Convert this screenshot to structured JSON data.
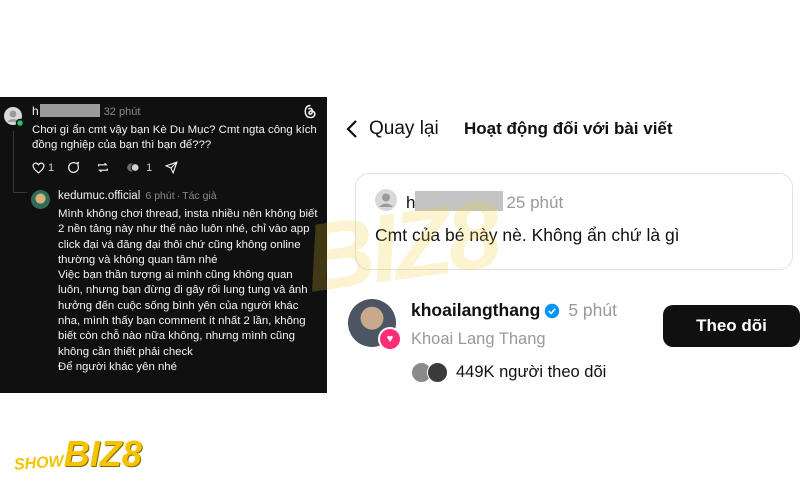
{
  "left_thread": {
    "comment": {
      "username_visible": "h",
      "time": "32 phút",
      "text": "Chơi gì ẩn cmt vậy bạn Kè Du Mục? Cmt ngta công kích đồng nghiệp của bạn thì bạn để???",
      "likes": "1",
      "reposts": "1"
    },
    "reply": {
      "username": "kedumuc.official",
      "time": "6 phút",
      "role": "Tác giả",
      "paragraphs": [
        "Mình không chơi thread, insta nhiều nên không biết 2 nền tảng này như thế nào luôn nhé, chỉ vào app click đại và đăng đại thôi chứ cũng không online thường và không quan tâm nhé",
        "Việc bạn thần tượng ai mình cũng không quan luôn, nhưng bạn đừng đi gây rối lung tung và ảnh hưởng đến cuộc sống bình yên của người khác nha, mình thấy bạn comment ít nhất 2 lần, không biết còn chỗ nào nữa không, nhưng mình cũng không cần thiết phải check",
        "Để người khác yên nhé"
      ]
    }
  },
  "right_activity": {
    "back_label": "Quay lại",
    "title": "Hoạt động đối với bài viết",
    "comment": {
      "username_visible": "h",
      "time": "25 phút",
      "text": "Cmt của bé này nè. Không ẩn chứ là gì"
    },
    "user": {
      "username": "khoailangthang",
      "time": "5 phút",
      "full_name": "Khoai Lang Thang",
      "follow_label": "Theo dõi",
      "followers_text": "449K người theo dõi"
    }
  },
  "branding": {
    "logo_small": "SHOW",
    "logo_big": "BIZ8",
    "accent_color": "#f5c400"
  }
}
